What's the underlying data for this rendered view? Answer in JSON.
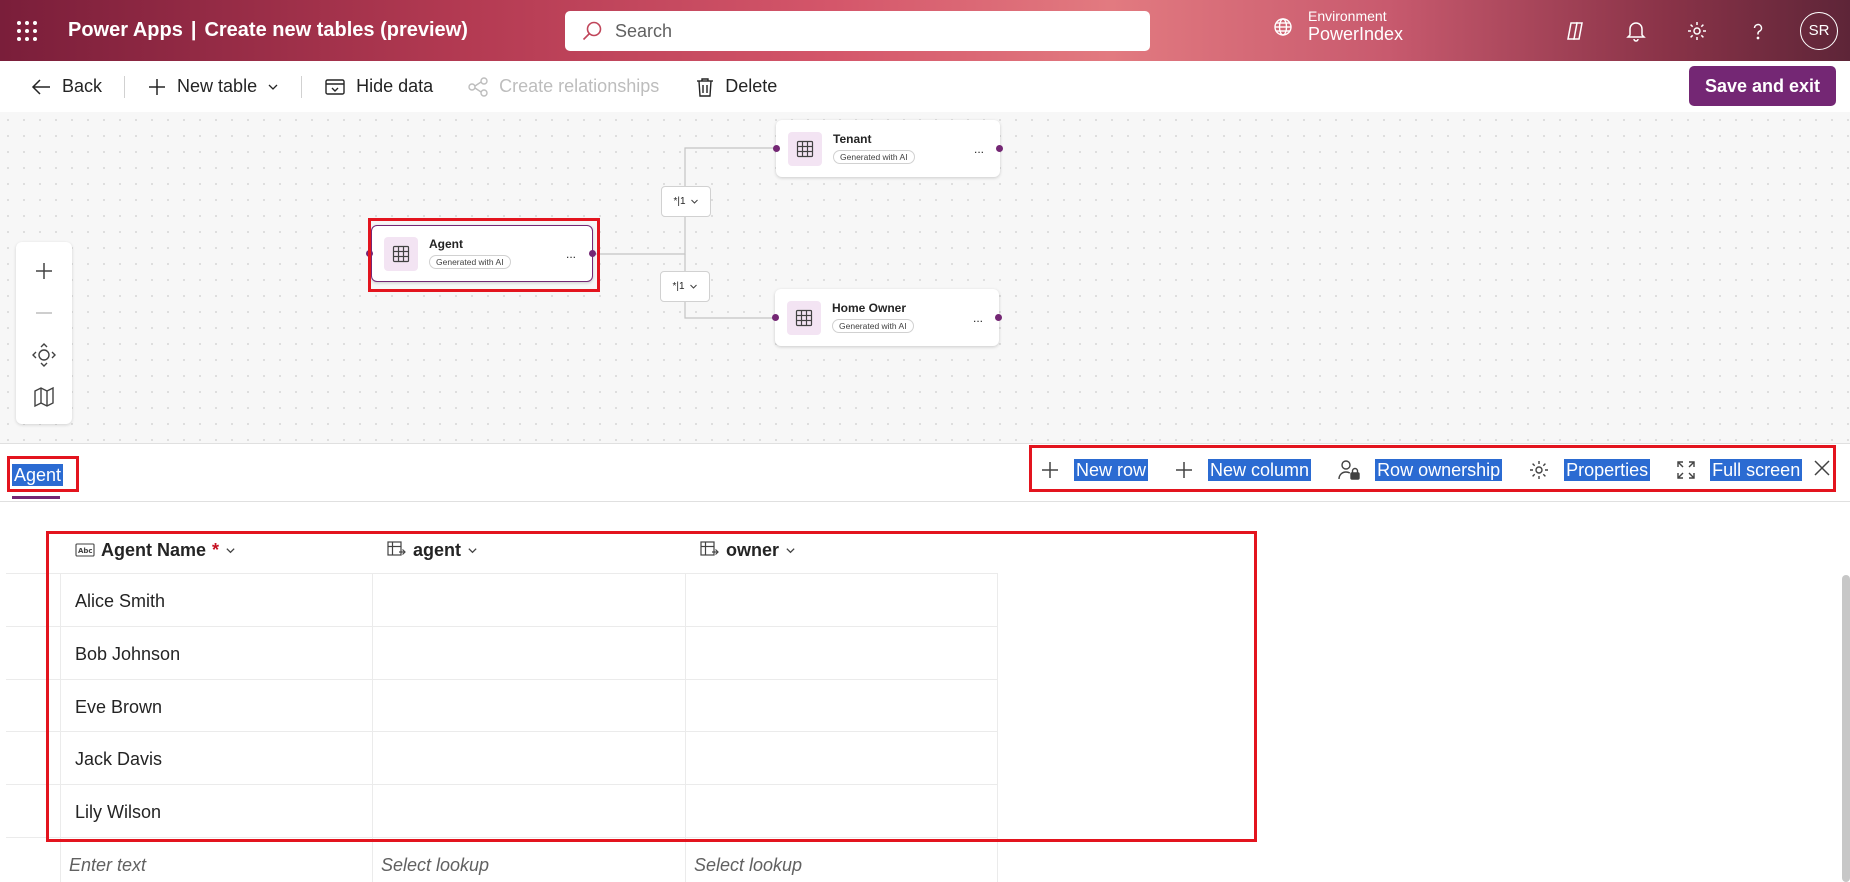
{
  "header": {
    "app_name": "Power Apps",
    "separator": "|",
    "page_title": "Create new tables (preview)",
    "search_placeholder": "Search",
    "environment_label": "Environment",
    "environment_value": "PowerIndex",
    "avatar_initials": "SR"
  },
  "commandbar": {
    "back": "Back",
    "new_table": "New table",
    "hide_data": "Hide data",
    "create_relationships": "Create relationships",
    "delete": "Delete",
    "save_and_exit": "Save and exit"
  },
  "canvas": {
    "nodes": [
      {
        "title": "Tenant",
        "badge": "Generated with AI"
      },
      {
        "title": "Agent",
        "badge": "Generated with AI"
      },
      {
        "title": "Home Owner",
        "badge": "Generated with AI"
      }
    ],
    "node_more": "...",
    "relationship_label": "*|1"
  },
  "table_panel": {
    "active_tab": "Agent",
    "actions": {
      "new_row": "New row",
      "new_column": "New column",
      "row_ownership": "Row ownership",
      "properties": "Properties",
      "full_screen": "Full screen"
    }
  },
  "grid": {
    "columns": [
      {
        "label": "Agent Name",
        "required_mark": "*"
      },
      {
        "label": "agent"
      },
      {
        "label": "owner"
      }
    ],
    "rows": [
      "Alice Smith",
      "Bob Johnson",
      "Eve Brown",
      "Jack Davis",
      "Lily Wilson"
    ],
    "new_row_placeholders": [
      "Enter text",
      "Select lookup",
      "Select lookup"
    ]
  },
  "colors": {
    "accent": "#742774",
    "highlight": "#2b6bd2",
    "annotation_red": "#e3141e"
  }
}
